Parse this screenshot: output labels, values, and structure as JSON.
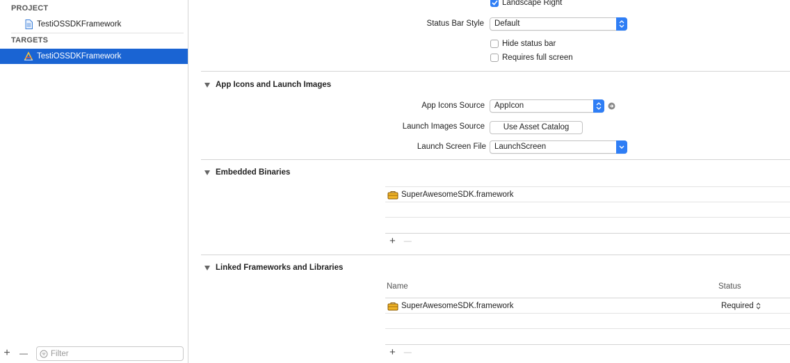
{
  "sidebar": {
    "project_header": "PROJECT",
    "project_item": "TestiOSSDKFramework",
    "targets_header": "TARGETS",
    "target_item": "TestiOSSDKFramework",
    "filter_placeholder": "Filter",
    "add_label": "+",
    "remove_label": "—"
  },
  "deployment": {
    "landscape_right_label": "Landscape Right",
    "landscape_right_checked": true,
    "status_bar_style_label": "Status Bar Style",
    "status_bar_style_value": "Default",
    "hide_status_bar_label": "Hide status bar",
    "hide_status_bar_checked": false,
    "requires_full_screen_label": "Requires full screen",
    "requires_full_screen_checked": false
  },
  "app_icons": {
    "title": "App Icons and Launch Images",
    "icons_source_label": "App Icons Source",
    "icons_source_value": "AppIcon",
    "launch_images_label": "Launch Images Source",
    "launch_images_button": "Use Asset Catalog",
    "launch_screen_label": "Launch Screen File",
    "launch_screen_value": "LaunchScreen"
  },
  "embedded": {
    "title": "Embedded Binaries",
    "items": [
      "SuperAwesomeSDK.framework"
    ],
    "add_label": "+",
    "remove_label": "—"
  },
  "linked": {
    "title": "Linked Frameworks and Libraries",
    "col_name": "Name",
    "col_status": "Status",
    "items": [
      {
        "name": "SuperAwesomeSDK.framework",
        "status": "Required"
      }
    ],
    "add_label": "+",
    "remove_label": "—"
  },
  "colors": {
    "selection": "#1a64d3",
    "accent": "#2f7ef5"
  }
}
